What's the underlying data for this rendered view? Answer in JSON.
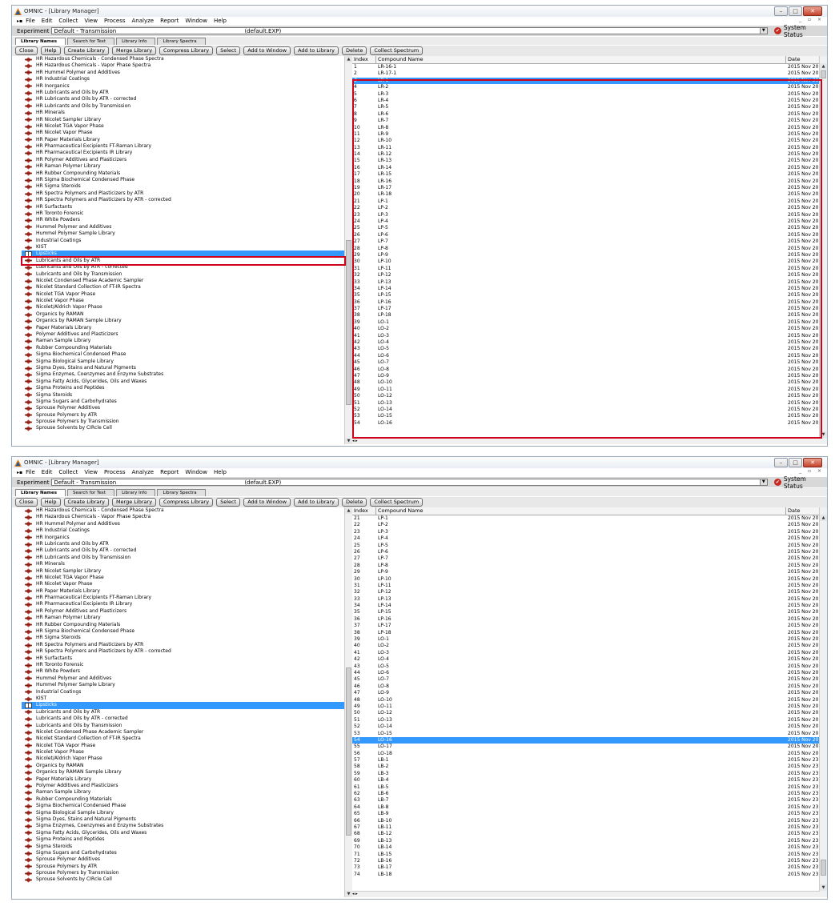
{
  "window": {
    "title": "OMNIC - [Library Manager]",
    "menu": [
      "File",
      "Edit",
      "Collect",
      "View",
      "Process",
      "Analyze",
      "Report",
      "Window",
      "Help"
    ],
    "experiment_label": "Experiment",
    "experiment_value": "Default - Transmission",
    "experiment_file": "(default.EXP)",
    "system_status": "System Status",
    "tabs": [
      "Library Names",
      "Search for Text",
      "Library Info",
      "Library Spectra"
    ],
    "toolbar": [
      "Close",
      "Help",
      "Create Library",
      "Merge Library",
      "Compress Library",
      "Select",
      "Add to Window",
      "Add to Library",
      "Delete",
      "Collect Spectrum"
    ],
    "col_index": "Index",
    "col_name": "Compound Name",
    "col_date": "Date",
    "col_extra": "De"
  },
  "colors": {
    "selection": "#3399ff",
    "highlight_box": "#d0021b",
    "icon": "#c0392b"
  },
  "libraries_top": [
    "HR Hazardous Chemicals - Condensed Phase Spectra",
    "HR Hazardous Chemicals - Vapor Phase Spectra",
    "HR Hummel Polymer and Additives",
    "HR Industrial Coatings",
    "HR Inorganics",
    "HR Lubricants and Oils by ATR",
    "HR Lubricants and Oils by ATR - corrected",
    "HR Lubricants and Oils by Transmission",
    "HR Minerals",
    "HR Nicolet Sampler Library",
    "HR Nicolet TGA Vapor Phase",
    "HR Nicolet Vapor Phase",
    "HR Paper Materials Library",
    "HR Pharmaceutical Excipients FT-Raman Library",
    "HR Pharmaceutical Excipients IR Library",
    "HR Polymer Additives and Plasticizers",
    "HR Raman Polymer Library",
    "HR Rubber Compounding Materials",
    "HR Sigma Biochemical Condensed Phase",
    "HR Sigma Steroids",
    "HR Spectra Polymers and Plasticizers by ATR",
    "HR Spectra Polymers and Plasticizers by ATR - corrected",
    "HR Surfactants",
    "HR Toronto Forensic",
    "HR White Powders",
    "Hummel Polymer and Additives",
    "Hummel Polymer Sample Library",
    "Industrial Coatings",
    "KIST",
    "Lipsticks",
    "Lubricants and Oils by ATR",
    "Lubricants and Oils by ATR - corrected",
    "Lubricants and Oils by Transmission",
    "Nicolet Condensed Phase Academic Sampler",
    "Nicolet Standard Collection of FT-IR Spectra",
    "Nicolet TGA Vapor Phase",
    "Nicolet Vapor Phase",
    "Nicolet/Aldrich Vapor Phase",
    "Organics by RAMAN",
    "Organics by RAMAN Sample Library",
    "Paper Materials Library",
    "Polymer Additives and Plasticizers",
    "Raman Sample Library",
    "Rubber Compounding Materials",
    "Sigma Biochemical Condensed Phase",
    "Sigma Biological Sample Library",
    "Sigma Dyes, Stains and Natural Pigments",
    "Sigma Enzymes, Coenzymes and Enzyme Substrates",
    "Sigma Fatty Acids, Glycerides, Oils and Waxes",
    "Sigma Proteins and Peptides",
    "Sigma Steroids",
    "Sigma Sugars and Carbohydrates",
    "Sprouse Polymer Additives",
    "Sprouse Polymers by ATR",
    "Sprouse Polymers by Transmission",
    "Sprouse Solvents by CIRcle Cell"
  ],
  "libraries_top_selected": 29,
  "libraries_bottom": [
    "HR Hazardous Chemicals - Condensed Phase Spectra",
    "HR Hazardous Chemicals - Vapor Phase Spectra",
    "HR Hummel Polymer and Additives",
    "HR Industrial Coatings",
    "HR Inorganics",
    "HR Lubricants and Oils by ATR",
    "HR Lubricants and Oils by ATR - corrected",
    "HR Lubricants and Oils by Transmission",
    "HR Minerals",
    "HR Nicolet Sampler Library",
    "HR Nicolet TGA Vapor Phase",
    "HR Nicolet Vapor Phase",
    "HR Paper Materials Library",
    "HR Pharmaceutical Excipients FT-Raman Library",
    "HR Pharmaceutical Excipients IR Library",
    "HR Polymer Additives and Plasticizers",
    "HR Raman Polymer Library",
    "HR Rubber Compounding Materials",
    "HR Sigma Biochemical Condensed Phase",
    "HR Sigma Steroids",
    "HR Spectra Polymers and Plasticizers by ATR",
    "HR Spectra Polymers and Plasticizers by ATR - corrected",
    "HR Surfactants",
    "HR Toronto Forensic",
    "HR White Powders",
    "Hummel Polymer and Additives",
    "Hummel Polymer Sample Library",
    "Industrial Coatings",
    "KIST",
    "Lipsticks",
    "Lubricants and Oils by ATR",
    "Lubricants and Oils by ATR - corrected",
    "Lubricants and Oils by Transmission",
    "Nicolet Condensed Phase Academic Sampler",
    "Nicolet Standard Collection of FT-IR Spectra",
    "Nicolet TGA Vapor Phase",
    "Nicolet Vapor Phase",
    "Nicolet/Aldrich Vapor Phase",
    "Organics by RAMAN",
    "Organics by RAMAN Sample Library",
    "Paper Materials Library",
    "Polymer Additives and Plasticizers",
    "Raman Sample Library",
    "Rubber Compounding Materials",
    "Sigma Biochemical Condensed Phase",
    "Sigma Biological Sample Library",
    "Sigma Dyes, Stains and Natural Pigments",
    "Sigma Enzymes, Coenzymes and Enzyme Substrates",
    "Sigma Fatty Acids, Glycerides, Oils and Waxes",
    "Sigma Proteins and Peptides",
    "Sigma Steroids",
    "Sigma Sugars and Carbohydrates",
    "Sprouse Polymer Additives",
    "Sprouse Polymers by ATR",
    "Sprouse Polymers by Transmission",
    "Sprouse Solvents by CIRcle Cell"
  ],
  "libraries_bottom_selected": 29,
  "compounds_top": [
    [
      "1",
      "LR-16-1",
      "2015 Nov 20"
    ],
    [
      "2",
      "LR-17-1",
      "2015 Nov 20"
    ],
    [
      "3",
      "LR-1",
      "2015 Nov 20"
    ],
    [
      "4",
      "LR-2",
      "2015 Nov 20"
    ],
    [
      "5",
      "LR-3",
      "2015 Nov 20"
    ],
    [
      "6",
      "LR-4",
      "2015 Nov 20"
    ],
    [
      "7",
      "LR-5",
      "2015 Nov 20"
    ],
    [
      "8",
      "LR-6",
      "2015 Nov 20"
    ],
    [
      "9",
      "LR-7",
      "2015 Nov 20"
    ],
    [
      "10",
      "LR-8",
      "2015 Nov 20"
    ],
    [
      "11",
      "LR-9",
      "2015 Nov 20"
    ],
    [
      "12",
      "LR-10",
      "2015 Nov 20"
    ],
    [
      "13",
      "LR-11",
      "2015 Nov 20"
    ],
    [
      "14",
      "LR-12",
      "2015 Nov 20"
    ],
    [
      "15",
      "LR-13",
      "2015 Nov 20"
    ],
    [
      "16",
      "LR-14",
      "2015 Nov 20"
    ],
    [
      "17",
      "LR-15",
      "2015 Nov 20"
    ],
    [
      "18",
      "LR-16",
      "2015 Nov 20"
    ],
    [
      "19",
      "LR-17",
      "2015 Nov 20"
    ],
    [
      "20",
      "LR-18",
      "2015 Nov 20"
    ],
    [
      "21",
      "LP-1",
      "2015 Nov 20"
    ],
    [
      "22",
      "LP-2",
      "2015 Nov 20"
    ],
    [
      "23",
      "LP-3",
      "2015 Nov 20"
    ],
    [
      "24",
      "LP-4",
      "2015 Nov 20"
    ],
    [
      "25",
      "LP-5",
      "2015 Nov 20"
    ],
    [
      "26",
      "LP-6",
      "2015 Nov 20"
    ],
    [
      "27",
      "LP-7",
      "2015 Nov 20"
    ],
    [
      "28",
      "LP-8",
      "2015 Nov 20"
    ],
    [
      "29",
      "LP-9",
      "2015 Nov 20"
    ],
    [
      "30",
      "LP-10",
      "2015 Nov 20"
    ],
    [
      "31",
      "LP-11",
      "2015 Nov 20"
    ],
    [
      "32",
      "LP-12",
      "2015 Nov 20"
    ],
    [
      "33",
      "LP-13",
      "2015 Nov 20"
    ],
    [
      "34",
      "LP-14",
      "2015 Nov 20"
    ],
    [
      "35",
      "LP-15",
      "2015 Nov 20"
    ],
    [
      "36",
      "LP-16",
      "2015 Nov 20"
    ],
    [
      "37",
      "LP-17",
      "2015 Nov 20"
    ],
    [
      "38",
      "LP-18",
      "2015 Nov 20"
    ],
    [
      "39",
      "LO-1",
      "2015 Nov 20"
    ],
    [
      "40",
      "LO-2",
      "2015 Nov 20"
    ],
    [
      "41",
      "LO-3",
      "2015 Nov 20"
    ],
    [
      "42",
      "LO-4",
      "2015 Nov 20"
    ],
    [
      "43",
      "LO-5",
      "2015 Nov 20"
    ],
    [
      "44",
      "LO-6",
      "2015 Nov 20"
    ],
    [
      "45",
      "LO-7",
      "2015 Nov 20"
    ],
    [
      "46",
      "LO-8",
      "2015 Nov 20"
    ],
    [
      "47",
      "LO-9",
      "2015 Nov 20"
    ],
    [
      "48",
      "LO-10",
      "2015 Nov 20"
    ],
    [
      "49",
      "LO-11",
      "2015 Nov 20"
    ],
    [
      "50",
      "LO-12",
      "2015 Nov 20"
    ],
    [
      "51",
      "LO-13",
      "2015 Nov 20"
    ],
    [
      "52",
      "LO-14",
      "2015 Nov 20"
    ],
    [
      "53",
      "LO-15",
      "2015 Nov 20"
    ],
    [
      "54",
      "LO-16",
      "2015 Nov 20"
    ]
  ],
  "compounds_top_selected": 2,
  "compounds_bottom": [
    [
      "21",
      "LP-1",
      "2015 Nov 20"
    ],
    [
      "22",
      "LP-2",
      "2015 Nov 20"
    ],
    [
      "23",
      "LP-3",
      "2015 Nov 20"
    ],
    [
      "24",
      "LP-4",
      "2015 Nov 20"
    ],
    [
      "25",
      "LP-5",
      "2015 Nov 20"
    ],
    [
      "26",
      "LP-6",
      "2015 Nov 20"
    ],
    [
      "27",
      "LP-7",
      "2015 Nov 20"
    ],
    [
      "28",
      "LP-8",
      "2015 Nov 20"
    ],
    [
      "29",
      "LP-9",
      "2015 Nov 20"
    ],
    [
      "30",
      "LP-10",
      "2015 Nov 20"
    ],
    [
      "31",
      "LP-11",
      "2015 Nov 20"
    ],
    [
      "32",
      "LP-12",
      "2015 Nov 20"
    ],
    [
      "33",
      "LP-13",
      "2015 Nov 20"
    ],
    [
      "34",
      "LP-14",
      "2015 Nov 20"
    ],
    [
      "35",
      "LP-15",
      "2015 Nov 20"
    ],
    [
      "36",
      "LP-16",
      "2015 Nov 20"
    ],
    [
      "37",
      "LP-17",
      "2015 Nov 20"
    ],
    [
      "38",
      "LP-18",
      "2015 Nov 20"
    ],
    [
      "39",
      "LO-1",
      "2015 Nov 20"
    ],
    [
      "40",
      "LO-2",
      "2015 Nov 20"
    ],
    [
      "41",
      "LO-3",
      "2015 Nov 20"
    ],
    [
      "42",
      "LO-4",
      "2015 Nov 20"
    ],
    [
      "43",
      "LO-5",
      "2015 Nov 20"
    ],
    [
      "44",
      "LO-6",
      "2015 Nov 20"
    ],
    [
      "45",
      "LO-7",
      "2015 Nov 20"
    ],
    [
      "46",
      "LO-8",
      "2015 Nov 20"
    ],
    [
      "47",
      "LO-9",
      "2015 Nov 20"
    ],
    [
      "48",
      "LO-10",
      "2015 Nov 20"
    ],
    [
      "49",
      "LO-11",
      "2015 Nov 20"
    ],
    [
      "50",
      "LO-12",
      "2015 Nov 20"
    ],
    [
      "51",
      "LO-13",
      "2015 Nov 20"
    ],
    [
      "52",
      "LO-14",
      "2015 Nov 20"
    ],
    [
      "53",
      "LO-15",
      "2015 Nov 20"
    ],
    [
      "54",
      "LO-16",
      "2015 Nov 20"
    ],
    [
      "55",
      "LO-17",
      "2015 Nov 20"
    ],
    [
      "56",
      "LO-18",
      "2015 Nov 20"
    ],
    [
      "57",
      "LB-1",
      "2015 Nov 23"
    ],
    [
      "58",
      "LB-2",
      "2015 Nov 23"
    ],
    [
      "59",
      "LB-3",
      "2015 Nov 23"
    ],
    [
      "60",
      "LB-4",
      "2015 Nov 23"
    ],
    [
      "61",
      "LB-5",
      "2015 Nov 23"
    ],
    [
      "62",
      "LB-6",
      "2015 Nov 23"
    ],
    [
      "63",
      "LB-7",
      "2015 Nov 23"
    ],
    [
      "64",
      "LB-8",
      "2015 Nov 23"
    ],
    [
      "65",
      "LB-9",
      "2015 Nov 23"
    ],
    [
      "66",
      "LB-10",
      "2015 Nov 23"
    ],
    [
      "67",
      "LB-11",
      "2015 Nov 23"
    ],
    [
      "68",
      "LB-12",
      "2015 Nov 23"
    ],
    [
      "69",
      "LB-13",
      "2015 Nov 23"
    ],
    [
      "70",
      "LB-14",
      "2015 Nov 23"
    ],
    [
      "71",
      "LB-15",
      "2015 Nov 23"
    ],
    [
      "72",
      "LB-16",
      "2015 Nov 23"
    ],
    [
      "73",
      "LB-17",
      "2015 Nov 23"
    ],
    [
      "74",
      "LB-18",
      "2015 Nov 23"
    ]
  ],
  "compounds_bottom_selected": 33
}
